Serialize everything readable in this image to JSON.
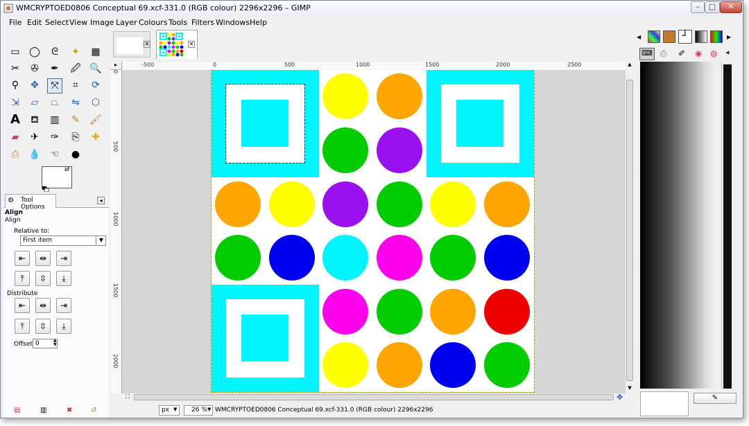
{
  "window": {
    "title": "WMCRYPTOED0806 Conceptual 69.xcf-331.0 (RGB colour) 2296x2296 – GIMP",
    "minimize": "–",
    "maximize": "□",
    "close": "✕"
  },
  "menus": [
    "File",
    "Edit",
    "Select",
    "View",
    "Image",
    "Layer",
    "Colours",
    "Tools",
    "Filters",
    "Windows",
    "Help"
  ],
  "tooloptions": {
    "tab_label": "Tool Options",
    "section_title": "Align",
    "subtitle": "Align",
    "relative_label": "Relative to:",
    "relative_value": "First item",
    "distribute_label": "Distribute",
    "offset_label": "Offset:",
    "offset_value": "0"
  },
  "ruler": {
    "h_ticks": [
      "-500",
      "0",
      "500",
      "1000",
      "1500",
      "2000",
      "2500"
    ],
    "v_ticks": [
      "0",
      "500",
      "1000",
      "1500",
      "2000"
    ]
  },
  "status": {
    "unit": "px",
    "zoom": "26 %",
    "text": "WMCRYPTOED0806 Conceptual 69.xcf-331.0 (RGB colour) 2296x2296"
  },
  "colors": {
    "cyan": "#00f5ff",
    "yellow": "#ffff00",
    "orange": "#ffa500",
    "green": "#00cc00",
    "purple": "#9b11ee",
    "blue": "#0000ee",
    "magenta": "#ff00ee",
    "red": "#ee0000"
  },
  "image": {
    "circles": [
      [
        "yellow",
        "orange"
      ],
      [
        "green",
        "purple"
      ],
      [
        "orange",
        "yellow",
        "purple",
        "green",
        "yellow",
        "orange"
      ],
      [
        "green",
        "blue",
        "cyan",
        "magenta",
        "green",
        "blue"
      ],
      [
        "magenta",
        "green",
        "orange",
        "red"
      ],
      [
        "yellow",
        "orange",
        "blue",
        "green"
      ]
    ]
  }
}
